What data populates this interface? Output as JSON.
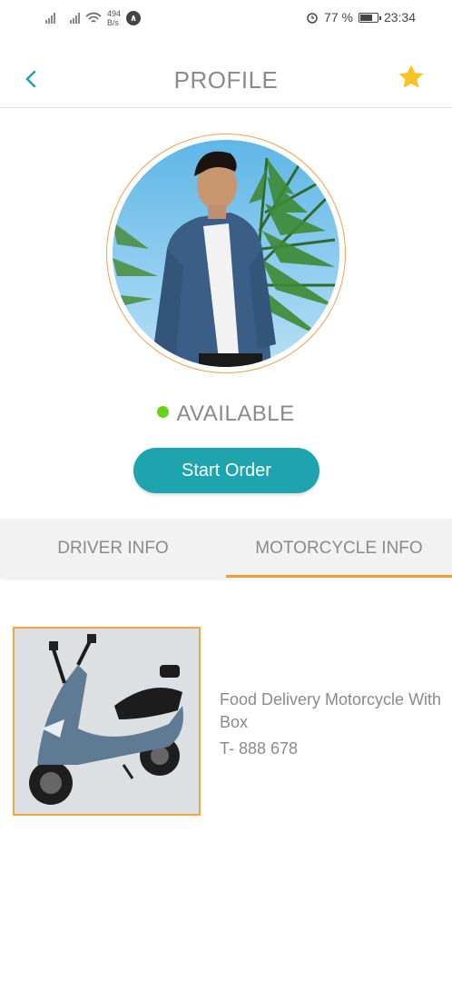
{
  "status_bar": {
    "net_speed_value": "494",
    "net_speed_unit": "B/s",
    "battery_percent": "77 %",
    "battery_level": 0.77,
    "time": "23:34"
  },
  "header": {
    "title": "PROFILE"
  },
  "profile": {
    "availability": "AVAILABLE",
    "availability_color": "#66d21a",
    "start_button_label": "Start Order"
  },
  "tabs": [
    {
      "label": "DRIVER INFO",
      "active": false
    },
    {
      "label": "MOTORCYCLE INFO",
      "active": true
    }
  ],
  "vehicle": {
    "name": "Food Delivery Motorcycle With Box",
    "plate": "T- 888 678"
  },
  "colors": {
    "accent_teal": "#1ea4ae",
    "accent_orange": "#f39a35",
    "star_yellow": "#f7c325"
  }
}
